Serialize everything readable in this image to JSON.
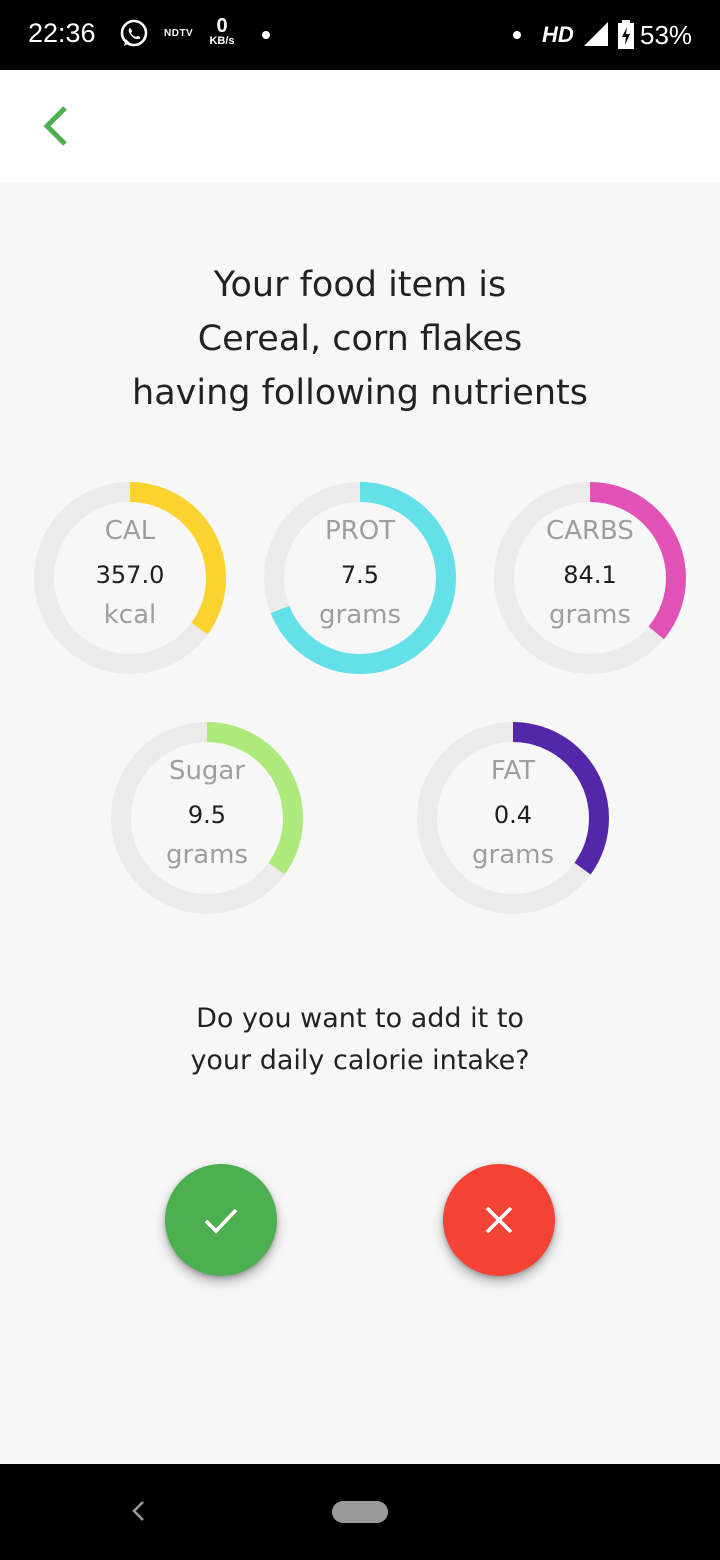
{
  "status_bar": {
    "time": "22:36",
    "ndtv": "NDTV",
    "speed_value": "0",
    "speed_unit": "KB/s",
    "network": "HD",
    "battery": "53%"
  },
  "app_bar": {
    "back_icon": "chevron-left-icon",
    "accent": "#4caf50"
  },
  "headline": {
    "line1": "Your food item is",
    "line2": "Cereal, corn flakes",
    "line3": "having following nutrients"
  },
  "nutrients": [
    {
      "label": "CAL",
      "value": "357.0",
      "unit": "kcal",
      "color": "#fbd22e",
      "fraction": 0.35
    },
    {
      "label": "PROT",
      "value": "7.5",
      "unit": "grams",
      "color": "#64e0e8",
      "fraction": 0.69
    },
    {
      "label": "CARBS",
      "value": "84.1",
      "unit": "grams",
      "color": "#e052b5",
      "fraction": 0.36
    },
    {
      "label": "Sugar",
      "value": "9.5",
      "unit": "grams",
      "color": "#aeea7b",
      "fraction": 0.35
    },
    {
      "label": "FAT",
      "value": "0.4",
      "unit": "grams",
      "color": "#5427a8",
      "fraction": 0.35
    }
  ],
  "ring_track_color": "#ebebeb",
  "question": {
    "line1": "Do you want to add it to",
    "line2": "your daily calorie intake?"
  },
  "actions": {
    "confirm_icon": "check-icon",
    "confirm_color": "#4caf50",
    "cancel_icon": "close-icon",
    "cancel_color": "#f44336"
  },
  "nav_bar": {
    "back_icon": "nav-back-icon",
    "home_icon": "home-pill-icon"
  }
}
